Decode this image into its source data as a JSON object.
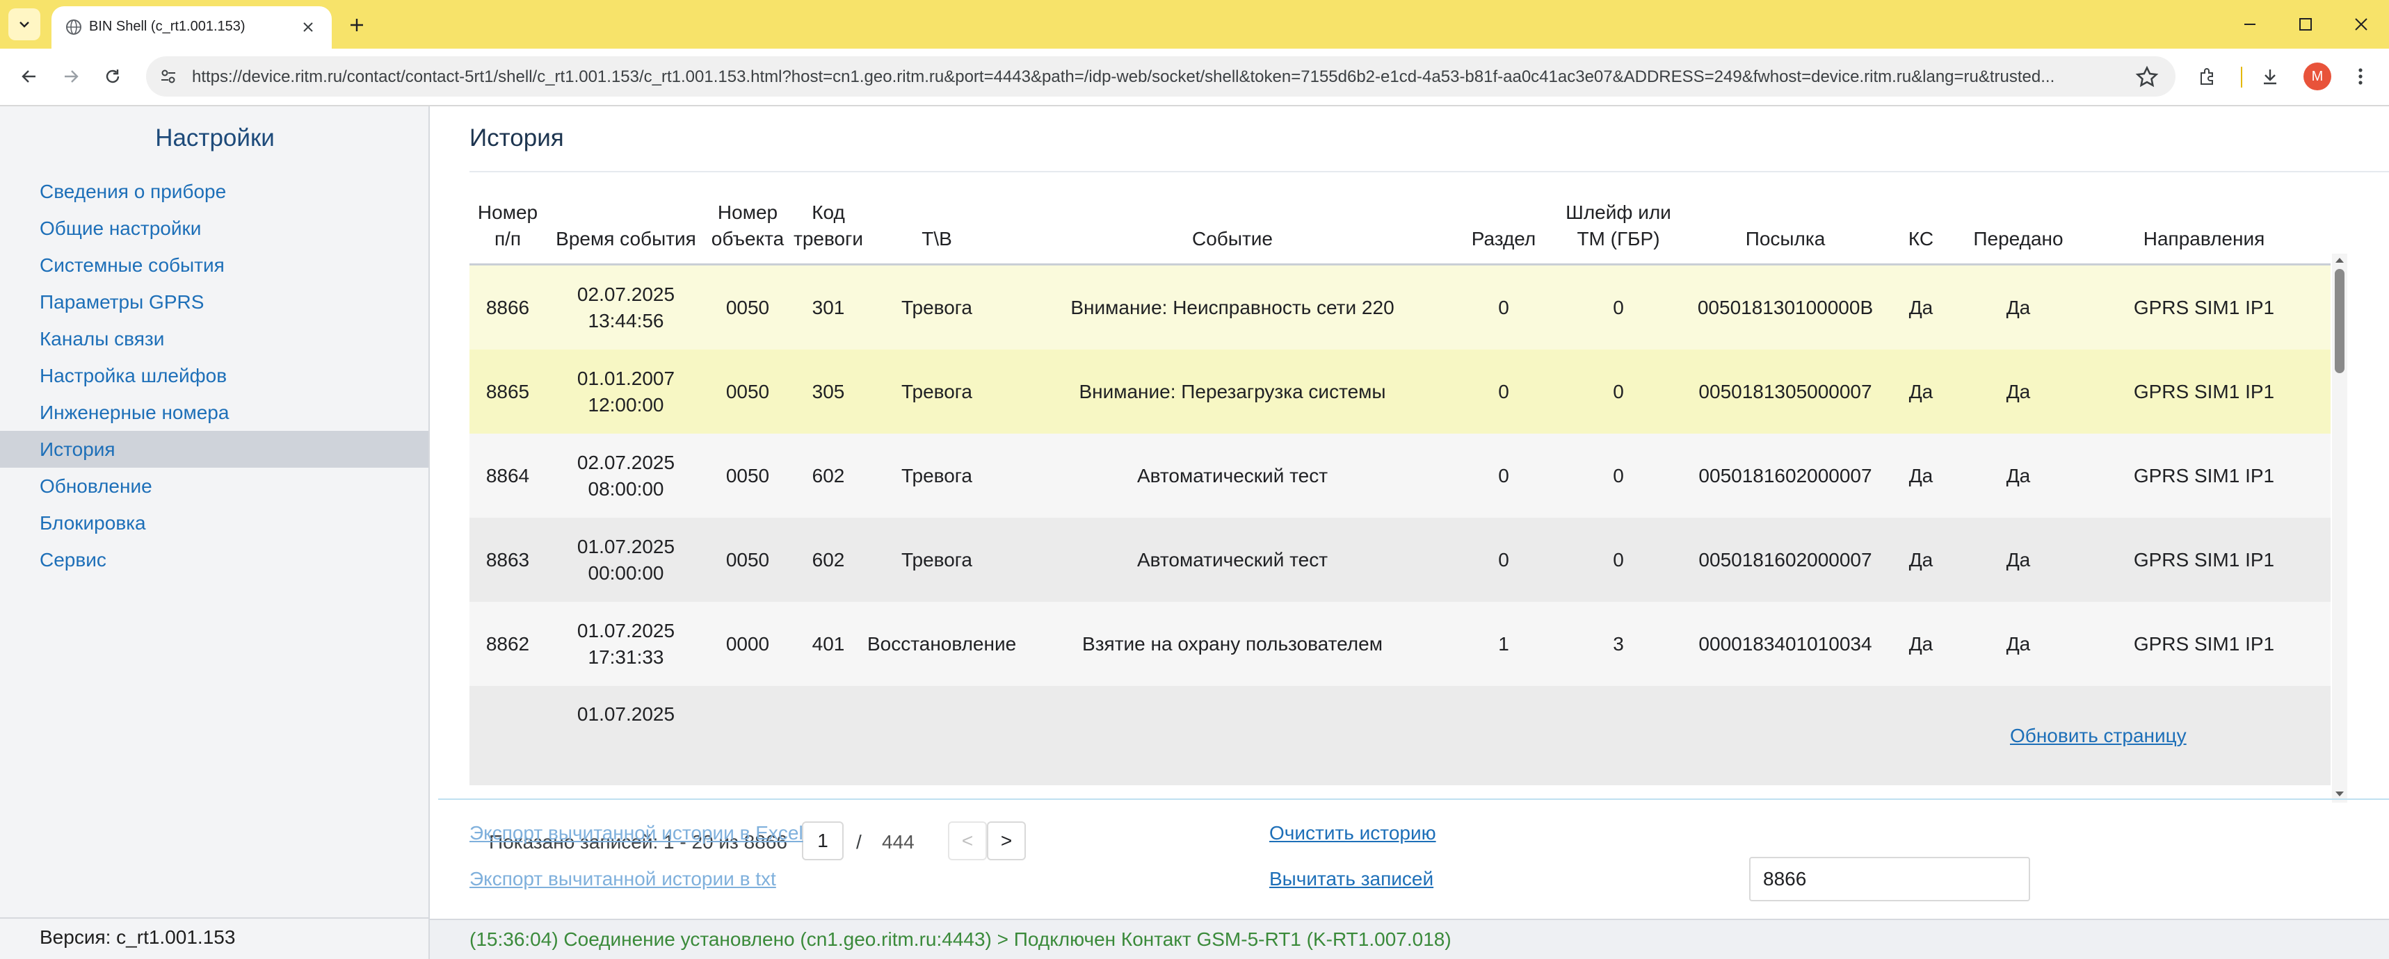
{
  "browser": {
    "tab_title": "BIN Shell (c_rt1.001.153)",
    "url": "https://device.ritm.ru/contact/contact-5rt1/shell/c_rt1.001.153/c_rt1.001.153.html?host=cn1.geo.ritm.ru&port=4443&path=/idp-web/socket/shell&token=7155d6b2-e1cd-4a53-b81f-aa0c41ac3e07&ADDRESS=249&fwhost=device.ritm.ru&lang=ru&trusted...",
    "profile_initial": "M",
    "tabbar_color": "#f7e36a"
  },
  "sidebar": {
    "title": "Настройки",
    "items": [
      {
        "label": "Сведения о приборе",
        "active": false
      },
      {
        "label": "Общие настройки",
        "active": false
      },
      {
        "label": "Системные события",
        "active": false
      },
      {
        "label": "Параметры GPRS",
        "active": false
      },
      {
        "label": "Каналы связи",
        "active": false
      },
      {
        "label": "Настройка шлейфов",
        "active": false
      },
      {
        "label": "Инженерные номера",
        "active": false
      },
      {
        "label": "История",
        "active": true
      },
      {
        "label": "Обновление",
        "active": false
      },
      {
        "label": "Блокировка",
        "active": false
      },
      {
        "label": "Сервис",
        "active": false
      }
    ],
    "version": "Версия: c_rt1.001.153"
  },
  "main": {
    "title": "История",
    "table": {
      "columns": [
        {
          "line1": "Номер",
          "line2": "п/п"
        },
        {
          "line1": "",
          "line2": "Время события"
        },
        {
          "line1": "Номер",
          "line2": "объекта"
        },
        {
          "line1": "Код",
          "line2": "тревоги"
        },
        {
          "line1": "",
          "line2": "Т\\В"
        },
        {
          "line1": "",
          "line2": "Событие"
        },
        {
          "line1": "",
          "line2": "Раздел"
        },
        {
          "line1": "Шлейф или",
          "line2": "ТМ (ГБР)"
        },
        {
          "line1": "",
          "line2": "Посылка"
        },
        {
          "line1": "",
          "line2": "КС"
        },
        {
          "line1": "",
          "line2": "Передано"
        },
        {
          "line1": "",
          "line2": "Направления"
        }
      ],
      "rows": [
        {
          "num": "8866",
          "date": "02.07.2025",
          "time": "13:44:56",
          "object": "0050",
          "code": "301",
          "tv": "Тревога",
          "event": "Внимание: Неисправность сети 220",
          "section": "0",
          "loop": "0",
          "message": "005018130100000B",
          "ks": "Да",
          "sent": "Да",
          "direction": "GPRS SIM1 IP1"
        },
        {
          "num": "8865",
          "date": "01.01.2007",
          "time": "12:00:00",
          "object": "0050",
          "code": "305",
          "tv": "Тревога",
          "event": "Внимание: Перезагрузка системы",
          "section": "0",
          "loop": "0",
          "message": "0050181305000007",
          "ks": "Да",
          "sent": "Да",
          "direction": "GPRS SIM1 IP1"
        },
        {
          "num": "8864",
          "date": "02.07.2025",
          "time": "08:00:00",
          "object": "0050",
          "code": "602",
          "tv": "Тревога",
          "event": "Автоматический тест",
          "section": "0",
          "loop": "0",
          "message": "0050181602000007",
          "ks": "Да",
          "sent": "Да",
          "direction": "GPRS SIM1 IP1"
        },
        {
          "num": "8863",
          "date": "01.07.2025",
          "time": "00:00:00",
          "object": "0050",
          "code": "602",
          "tv": "Тревога",
          "event": "Автоматический тест",
          "section": "0",
          "loop": "0",
          "message": "0050181602000007",
          "ks": "Да",
          "sent": "Да",
          "direction": "GPRS SIM1 IP1"
        },
        {
          "num": "8862",
          "date": "01.07.2025",
          "time": "17:31:33",
          "object": "0000",
          "code": "401",
          "tv": "Восстановление",
          "event": "Взятие на охрану пользователем",
          "section": "1",
          "loop": "3",
          "message": "0000183401010034",
          "ks": "Да",
          "sent": "Да",
          "direction": "GPRS SIM1 IP1"
        },
        {
          "num": "",
          "date": "01.07.2025",
          "time": "",
          "object": "",
          "code": "",
          "tv": "",
          "event": "",
          "section": "",
          "loop": "",
          "message": "",
          "ks": "",
          "sent": "",
          "direction": ""
        }
      ]
    },
    "pager": {
      "shown": "Показано записей: 1 - 20 из 8866",
      "page": "1",
      "sep": "/",
      "total": "444",
      "prev": "<",
      "next": ">",
      "refresh": "Обновить страницу"
    },
    "actions": {
      "export_excel": "Экспорт вычитанной истории в Excel",
      "export_txt": "Экспорт вычитанной истории в txt",
      "clear": "Очистить историю",
      "read": "Вычитать записей",
      "records_value": "8866"
    },
    "status": "(15:36:04) Соединение установлено (cn1.geo.ritm.ru:4443) > Подключен Контакт GSM-5-RT1 (K-RT1.007.018)"
  }
}
